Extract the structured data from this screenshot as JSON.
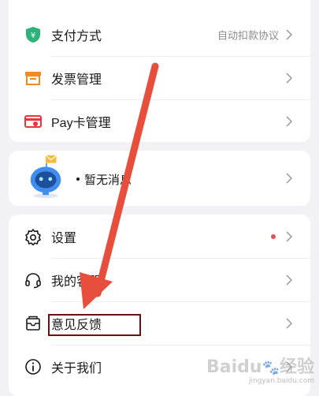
{
  "payment_card": {
    "items": [
      {
        "label": "支付方式",
        "value": "自动扣款协议",
        "icon": "payment-shield-icon",
        "icon_color": "#2db37a"
      },
      {
        "label": "发票管理",
        "value": "",
        "icon": "invoice-icon",
        "icon_color": "#f08a24"
      },
      {
        "label": "Pay卡管理",
        "value": "",
        "icon": "pay-card-icon",
        "icon_color": "#e8343e"
      }
    ]
  },
  "message_card": {
    "text": "暂无消息",
    "icon": "robot-mascot-icon"
  },
  "settings_card": {
    "items": [
      {
        "label": "设置",
        "icon": "gear-icon",
        "has_badge_dot": true,
        "dot_color": "#e84c5a"
      },
      {
        "label": "我的客服",
        "icon": "headset-icon"
      },
      {
        "label": "意见反馈",
        "icon": "feedback-mail-icon"
      },
      {
        "label": "关于我们",
        "icon": "info-circle-icon"
      }
    ]
  },
  "annotation": {
    "arrow_color": "#e84e3c",
    "box_color": "#6b1010"
  },
  "watermark": {
    "brand": "Baidu",
    "suffix": "经验",
    "url": "jingyan.baidu.com"
  }
}
